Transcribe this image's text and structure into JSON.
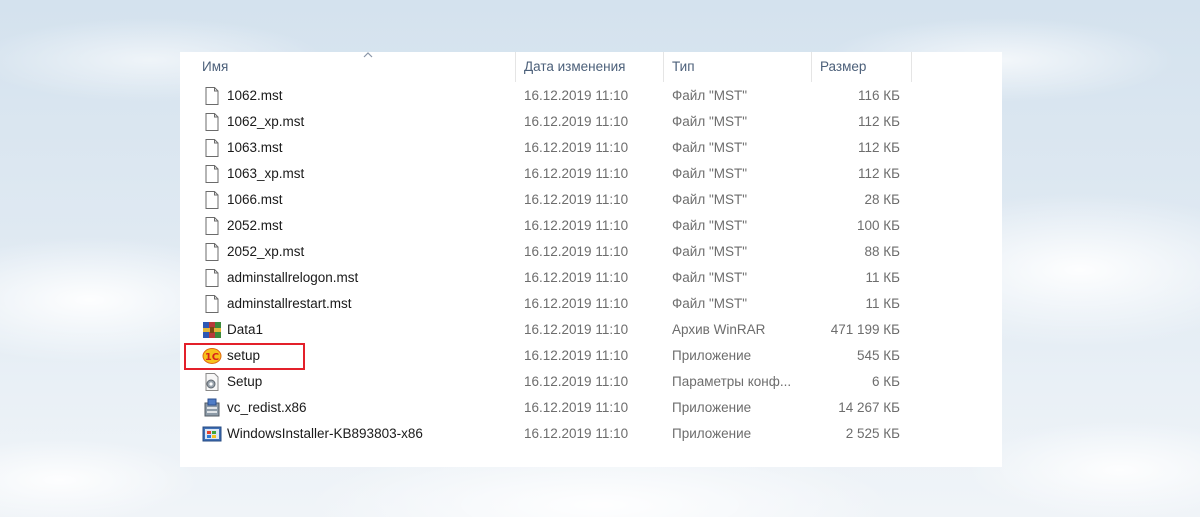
{
  "columns": {
    "name": "Имя",
    "date": "Дата изменения",
    "type": "Тип",
    "size": "Размер"
  },
  "highlight_color": "#e3202a",
  "files": [
    {
      "name": "1062.mst",
      "date": "16.12.2019 11:10",
      "type": "Файл \"MST\"",
      "size": "116 КБ",
      "icon": "document-icon"
    },
    {
      "name": "1062_xp.mst",
      "date": "16.12.2019 11:10",
      "type": "Файл \"MST\"",
      "size": "112 КБ",
      "icon": "document-icon"
    },
    {
      "name": "1063.mst",
      "date": "16.12.2019 11:10",
      "type": "Файл \"MST\"",
      "size": "112 КБ",
      "icon": "document-icon"
    },
    {
      "name": "1063_xp.mst",
      "date": "16.12.2019 11:10",
      "type": "Файл \"MST\"",
      "size": "112 КБ",
      "icon": "document-icon"
    },
    {
      "name": "1066.mst",
      "date": "16.12.2019 11:10",
      "type": "Файл \"MST\"",
      "size": "28 КБ",
      "icon": "document-icon"
    },
    {
      "name": "2052.mst",
      "date": "16.12.2019 11:10",
      "type": "Файл \"MST\"",
      "size": "100 КБ",
      "icon": "document-icon"
    },
    {
      "name": "2052_xp.mst",
      "date": "16.12.2019 11:10",
      "type": "Файл \"MST\"",
      "size": "88 КБ",
      "icon": "document-icon"
    },
    {
      "name": "adminstallrelogon.mst",
      "date": "16.12.2019 11:10",
      "type": "Файл \"MST\"",
      "size": "11 КБ",
      "icon": "document-icon"
    },
    {
      "name": "adminstallrestart.mst",
      "date": "16.12.2019 11:10",
      "type": "Файл \"MST\"",
      "size": "11 КБ",
      "icon": "document-icon"
    },
    {
      "name": "Data1",
      "date": "16.12.2019 11:10",
      "type": "Архив WinRAR",
      "size": "471 199 КБ",
      "icon": "winrar-archive-icon"
    },
    {
      "name": "setup",
      "date": "16.12.2019 11:10",
      "type": "Приложение",
      "size": "545 КБ",
      "icon": "1c-app-icon"
    },
    {
      "name": "Setup",
      "date": "16.12.2019 11:10",
      "type": "Параметры конф...",
      "size": "6 КБ",
      "icon": "config-settings-icon"
    },
    {
      "name": "vc_redist.x86",
      "date": "16.12.2019 11:10",
      "type": "Приложение",
      "size": "14 267 КБ",
      "icon": "installer-icon"
    },
    {
      "name": "WindowsInstaller-KB893803-x86",
      "date": "16.12.2019 11:10",
      "type": "Приложение",
      "size": "2 525 КБ",
      "icon": "windows-installer-icon"
    }
  ]
}
